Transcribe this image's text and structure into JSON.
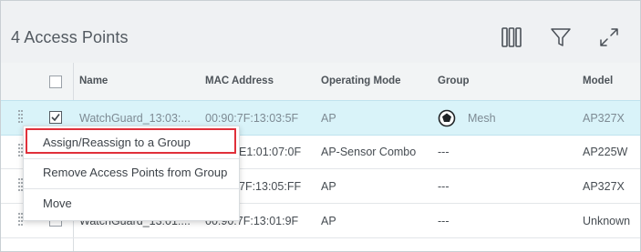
{
  "panel": {
    "title": "4 Access Points"
  },
  "toolbar": {
    "columns_icon": "columns-icon",
    "filter_icon": "filter-icon",
    "expand_icon": "expand-icon"
  },
  "columns": [
    "Name",
    "MAC Address",
    "Operating Mode",
    "Group",
    "Model"
  ],
  "rows": [
    {
      "name": "WatchGuard_13:03:...",
      "mac": "00:90:7F:13:03:5F",
      "mode": "AP",
      "group": "Mesh",
      "model": "AP327X",
      "checked": true,
      "selected": true
    },
    {
      "name": "",
      "mac": "E1:01:07:0F",
      "mode": "AP-Sensor Combo",
      "group": "---",
      "model": "AP225W",
      "checked": false,
      "selected": false
    },
    {
      "name": "",
      "mac": "7F:13:05:FF",
      "mode": "AP",
      "group": "---",
      "model": "AP327X",
      "checked": false,
      "selected": false
    },
    {
      "name": "WatchGuard_13:01:...",
      "mac": "00:90:7F:13:01:9F",
      "mode": "AP",
      "group": "---",
      "model": "Unknown",
      "checked": false,
      "selected": false
    }
  ],
  "context_menu": {
    "items": [
      "Assign/Reassign to a Group",
      "Remove Access Points from Group",
      "Move"
    ],
    "highlighted": "Assign/Reassign to a Group"
  },
  "colors": {
    "selected_row": "#d9f3f9",
    "highlight_border": "#e0303a",
    "header_bg": "#eff1f3"
  }
}
